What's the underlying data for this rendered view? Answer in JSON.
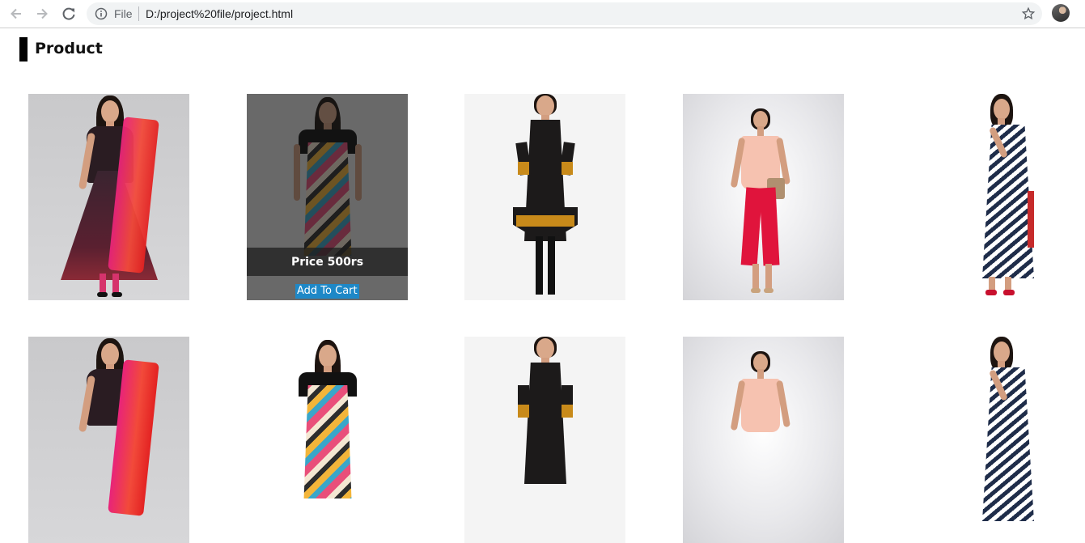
{
  "browser": {
    "omnibox_scheme": "File",
    "url": "D:/project%20file/project.html",
    "icons": [
      "back-arrow-icon",
      "forward-arrow-icon",
      "reload-icon",
      "info-icon",
      "star-icon",
      "avatar"
    ]
  },
  "page": {
    "heading": "Product",
    "accent_color": "#000000"
  },
  "products": [
    {
      "name": "anarkali-red-dupatta"
    },
    {
      "name": "chevron-kurti",
      "hover": true,
      "price_label": "Price 500rs",
      "cart_label": "Add To Cart",
      "cart_color": "#1e88c7"
    },
    {
      "name": "black-mustard-kurta"
    },
    {
      "name": "peach-top-red-trousers"
    },
    {
      "name": "chevron-print-long-kurta"
    },
    {
      "name": "anarkali-red-dupatta"
    },
    {
      "name": "chevron-kurti"
    },
    {
      "name": "black-mustard-kurta"
    },
    {
      "name": "peach-top-red-trousers"
    },
    {
      "name": "chevron-print-long-kurta"
    }
  ]
}
